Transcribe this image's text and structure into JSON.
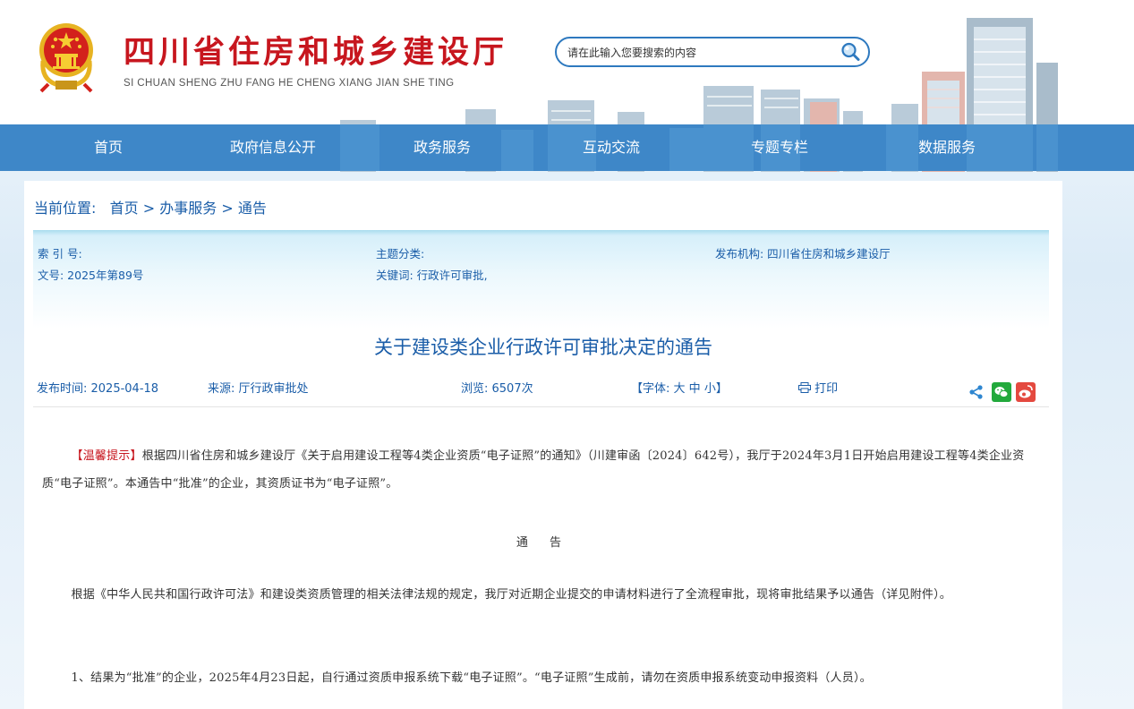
{
  "header": {
    "title": "四川省住房和城乡建设厅",
    "subtitle": "SI CHUAN SHENG ZHU FANG HE CHENG XIANG JIAN SHE TING",
    "search_placeholder": "请在此输入您要搜索的内容",
    "search_icon": "magnifier-icon",
    "emblem_icon": "national-emblem-icon"
  },
  "nav": {
    "items": [
      "首页",
      "政府信息公开",
      "政务服务",
      "互动交流",
      "专题专栏",
      "数据服务"
    ]
  },
  "breadcrumb": {
    "label": "当前位置:",
    "items": [
      "首页",
      "办事服务",
      "通告"
    ],
    "separator": ">"
  },
  "meta": {
    "index_no": "索 引 号:",
    "doc_no": "文号: 2025年第89号",
    "category": "主题分类:",
    "keywords": "关键词: 行政许可审批,",
    "publisher": "发布机构: 四川省住房和城乡建设厅"
  },
  "article": {
    "title": "关于建设类企业行政许可审批决定的通告",
    "publish_time": "发布时间: 2025-04-18",
    "source": "来源: 厅行政审批处",
    "views": "浏览: 6507次",
    "font_label_open": "【字体: ",
    "font_large": "大",
    "font_medium": "中",
    "font_small": "小",
    "font_label_close": "】",
    "print_label": "打印",
    "share_icons": [
      "share-icon",
      "wechat-icon",
      "weibo-icon"
    ],
    "tip_label": "【温馨提示】",
    "paragraph_1": "根据四川省住房和城乡建设厅《关于启用建设工程等4类企业资质“电子证照”的通知》（川建审函〔2024〕642号），我厅于2024年3月1日开始启用建设工程等4类企业资质“电子证照”。本通告中“批准”的企业，其资质证书为“电子证照”。",
    "notice_heading": "通 告",
    "paragraph_2": "根据《中华人民共和国行政许可法》和建设类资质管理的相关法律法规的规定，我厅对近期企业提交的申请材料进行了全流程审批，现将审批结果予以通告（详见附件）。",
    "paragraph_3": "1、结果为“批准”的企业，2025年4月23日起，自行通过资质申报系统下载“电子证照”。“电子证照”生成前，请勿在资质申报系统变动申报资料（人员）。"
  },
  "colors": {
    "brand_red": "#c7161e",
    "nav_blue": "#3e87c8",
    "link_blue": "#1a5da8"
  }
}
